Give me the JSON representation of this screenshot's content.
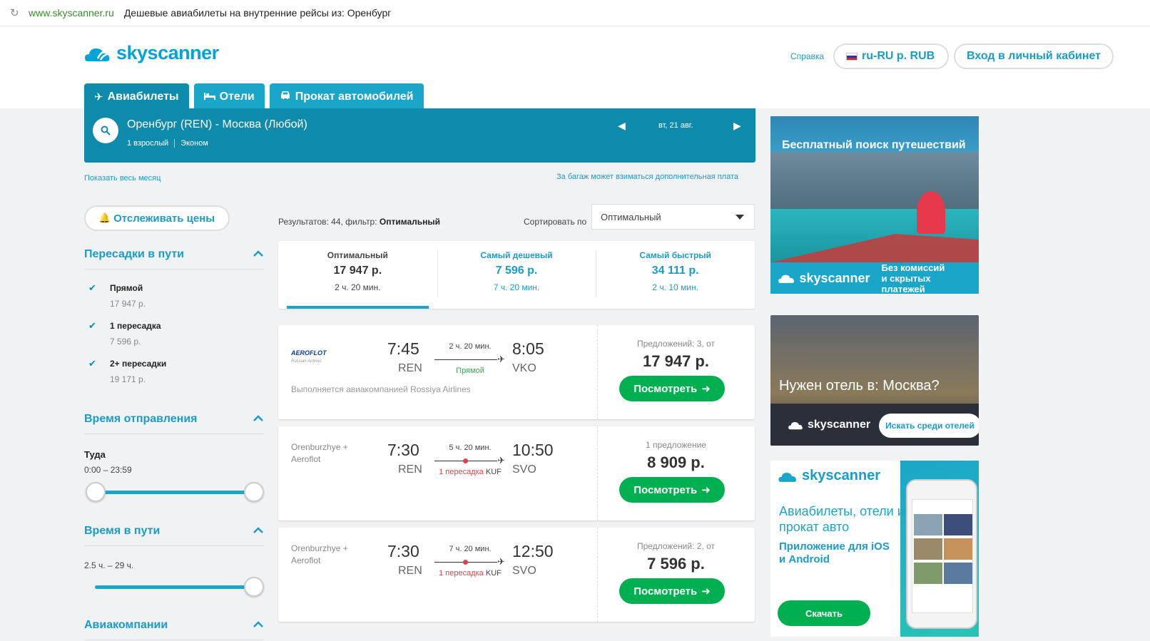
{
  "browser": {
    "domain": "www.skyscanner.ru",
    "title": "Дешевые авиабилеты на внутренние рейсы из: Оренбург"
  },
  "header": {
    "logo_text": "skyscanner",
    "help_label": "Справка",
    "locale_label": "ru-RU р. RUB",
    "login_label": "Вход в личный кабинет",
    "tabs": [
      {
        "label": "Авиабилеты",
        "icon": "plane-icon",
        "active": true
      },
      {
        "label": "Отели",
        "icon": "bed-icon",
        "active": false
      },
      {
        "label": "Прокат автомобилей",
        "icon": "car-icon",
        "active": false
      }
    ]
  },
  "search": {
    "route": "Оренбург (REN) - Москва (Любой)",
    "passengers": "1 взрослый",
    "cabin": "Эконом",
    "date": "вт, 21 авг."
  },
  "links": {
    "show_month": "Показать весь месяц",
    "baggage": "За багаж может взиматься дополнительная плата"
  },
  "sidebar": {
    "track_label": "Отслеживать цены",
    "stops": {
      "title": "Пересадки в пути",
      "items": [
        {
          "label": "Прямой",
          "price": "17 947 р.",
          "checked": true
        },
        {
          "label": "1 пересадка",
          "price": "7 596 р.",
          "checked": true
        },
        {
          "label": "2+ пересадки",
          "price": "19 171 р.",
          "checked": true
        }
      ]
    },
    "departure": {
      "title": "Время отправления",
      "direction": "Туда",
      "range": "0:00 – 23:59"
    },
    "duration": {
      "title": "Время в пути",
      "range": "2.5 ч. – 29 ч."
    },
    "airlines": {
      "title": "Авиакомпании"
    }
  },
  "results": {
    "count_prefix": "Результатов: 44, фильтр:",
    "count_filter": "Оптимальный",
    "sort_label": "Сортировать по",
    "sort_value": "Оптимальный",
    "tabs": [
      {
        "label": "Оптимальный",
        "price": "17 947 р.",
        "duration": "2 ч. 20 мин.",
        "active": true
      },
      {
        "label": "Самый дешевый",
        "price": "7 596 р.",
        "duration": "7 ч. 20 мин.",
        "active": false
      },
      {
        "label": "Самый быстрый",
        "price": "34 111 р.",
        "duration": "2 ч. 10 мин.",
        "active": false
      }
    ],
    "flights": [
      {
        "airline": "AEROFLOT",
        "airline_sub": "Russian Airlines",
        "operated": "Выполняется авиакомпанией Rossiya Airlines",
        "dep_time": "7:45",
        "dep_code": "REN",
        "arr_time": "8:05",
        "arr_code": "VKO",
        "duration": "2 ч. 20 мин.",
        "stops": "Прямой",
        "offers": "Предложений: 3, от",
        "price": "17 947 р.",
        "button": "Посмотреть"
      },
      {
        "airline_line1": "Orenburzhye +",
        "airline_line2": "Aeroflot",
        "dep_time": "7:30",
        "dep_code": "REN",
        "arr_time": "10:50",
        "arr_code": "SVO",
        "duration": "5 ч. 20 мин.",
        "stops": "1 пересадка",
        "stop_code": "KUF",
        "offers": "1 предложение",
        "price": "8 909 р.",
        "button": "Посмотреть"
      },
      {
        "airline_line1": "Orenburzhye +",
        "airline_line2": "Aeroflot",
        "dep_time": "7:30",
        "dep_code": "REN",
        "arr_time": "12:50",
        "arr_code": "SVO",
        "duration": "7 ч. 20 мин.",
        "stops": "1 пересадка",
        "stop_code": "KUF",
        "offers": "Предложений: 2, от",
        "price": "7 596 р.",
        "button": "Посмотреть"
      }
    ]
  },
  "ads": {
    "ad1": {
      "title": "Бесплатный поиск путешествий",
      "logo": "skyscanner",
      "line1": "Без комиссий",
      "line2": "и скрытых платежей"
    },
    "ad2": {
      "title": "Нужен отель в: Москва?",
      "logo": "skyscanner",
      "button": "Искать среди отелей"
    },
    "ad3": {
      "logo": "skyscanner",
      "line1": "Авиабилеты, отели и прокат авто",
      "line2": "Приложение для iOS и Android",
      "button": "Скачать"
    }
  },
  "colors": {
    "brand": "#1aa6c9",
    "brand_dark": "#0e8aab",
    "link": "#1a9cc8",
    "cta_green": "#00b050",
    "stop_red": "#e0424a"
  }
}
